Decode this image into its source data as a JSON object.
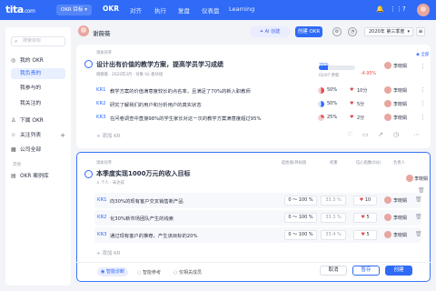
{
  "topbar": {
    "logo": "tita",
    "logo_suffix": ".com",
    "workspace": "OKR 目标 ▾",
    "nav": [
      "OKR",
      "对齐",
      "执行",
      "复盘",
      "仪表盘",
      "Learning"
    ]
  },
  "sidebar": {
    "search_placeholder": "搜索目标",
    "items": [
      {
        "label": "我的 OKR"
      },
      {
        "label": "我负责的"
      },
      {
        "label": "我参与的"
      },
      {
        "label": "我关注的"
      },
      {
        "label": "下属 OKR"
      },
      {
        "label": "关注列表"
      },
      {
        "label": "公司全部"
      },
      {
        "label": "OKR 案例库"
      }
    ],
    "group_label": "其他"
  },
  "header": {
    "user": "谢薇薇",
    "ai_label": "AI 创建",
    "create_label": "创建 OKR",
    "period": "2020年 第三季度"
  },
  "objective1": {
    "tag": "添加对齐",
    "title": "设计出有价值的教学方案，提高学员学习成绩",
    "meta": [
      "谢薇薇",
      "2022年3月",
      "对象 UL 板块组"
    ],
    "progress_pct": "25%",
    "progress_fraction": 0.25,
    "updated": "02/07 更新",
    "change": "-4.95%",
    "owner": "李晓娟",
    "ack": "全部",
    "krs": [
      {
        "code": "KR1",
        "text": "教学方案的价值满意度较长的点名率，且满足了70%的新入职教师",
        "pct": "50%",
        "conf": "10分",
        "owner": "李晓娟"
      },
      {
        "code": "KR2",
        "text": "研究了解我们的用户和分析用户的真实状态",
        "pct": "50%",
        "conf": "5分",
        "owner": "李晓娟"
      },
      {
        "code": "KR3",
        "text": "在问卷调查中直接98%的学生家长对这一次的教学方案满意度超过95%",
        "pct": "25%",
        "conf": "2分",
        "owner": "李晓娟"
      }
    ],
    "add_kr": "添加 KR"
  },
  "objective2": {
    "tag": "添加对齐",
    "title": "本季度实现1000万元的收入目标",
    "meta": [
      "个人",
      "未达成"
    ],
    "col_headers": [
      "起始值/目标值",
      "权重",
      "信心指数(0分)",
      "负责人"
    ],
    "owner": "李晓娟",
    "krs": [
      {
        "code": "KR1",
        "text": "向30%的现有客户交叉销售新产品",
        "range": "0 ～ 100 %",
        "weight": "33.3",
        "weight_unit": "%",
        "conf": "10",
        "owner": "李晓娟"
      },
      {
        "code": "KR2",
        "text": "化30%新市场团队产生的线索",
        "range": "0 ～ 100 %",
        "weight": "33.3",
        "weight_unit": "%",
        "conf": "5",
        "owner": "李晓娟"
      },
      {
        "code": "KR3",
        "text": "通过现有客户的推荐，产生该目标的20%",
        "range": "0 ～ 100 %",
        "weight": "33.4",
        "weight_unit": "%",
        "conf": "5",
        "owner": "李晓娟"
      }
    ],
    "add_kr": "添加 KR",
    "footer": {
      "tabs": [
        "智能诊断",
        "智能参考",
        "仅相关成员"
      ],
      "cancel": "取消",
      "save": "暂存",
      "create": "创建"
    }
  }
}
